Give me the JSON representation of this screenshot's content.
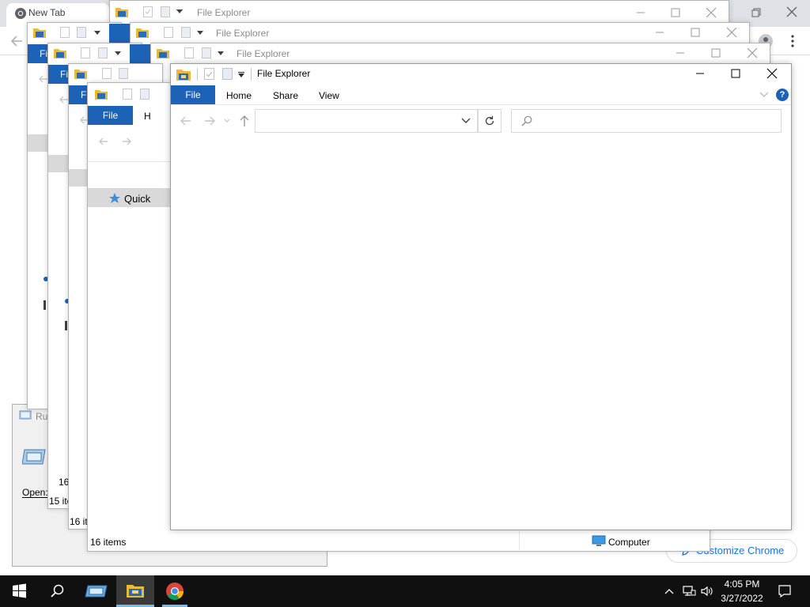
{
  "chrome": {
    "tab_title": "New Tab",
    "customize_label": "Customize Chrome"
  },
  "run_dialog": {
    "title": "Ru",
    "open_label": "Open:"
  },
  "explorer_back": [
    {
      "title": "File Explorer"
    },
    {
      "title": "File Explorer"
    },
    {
      "title": "File Explorer"
    }
  ],
  "explorer_left": [
    {
      "file_tab": "Fi",
      "status": "16"
    },
    {
      "file_tab": "Fi",
      "status": "15 ite"
    },
    {
      "file_tab": "Fi",
      "status": "16 it"
    },
    {
      "file_tab": "File",
      "home_partial": "H",
      "nav_item": "Quick",
      "status": "16 items",
      "status_right": "Computer"
    }
  ],
  "main_explorer": {
    "title": "File Explorer",
    "tabs": {
      "file": "File",
      "home": "Home",
      "share": "Share",
      "view": "View"
    },
    "help": "?",
    "address_value": "",
    "search_placeholder": ""
  },
  "taskbar": {
    "time": "4:05 PM",
    "date": "3/27/2022"
  },
  "colors": {
    "accent": "#1c63b7",
    "taskbar": "#101010",
    "chrome_frame": "#dee1e6",
    "link_blue": "#1a73e8"
  },
  "icons": [
    "chrome-logo-icon",
    "folder-icon",
    "checkbox-icon",
    "undo-icon",
    "dropdown-arrow-icon",
    "minimize-icon",
    "maximize-icon",
    "close-icon",
    "restore-icon",
    "back-arrow-icon",
    "forward-arrow-icon",
    "up-arrow-icon",
    "refresh-icon",
    "search-icon",
    "star-icon",
    "computer-icon",
    "windows-start-icon",
    "search-taskbar-icon",
    "run-app-icon",
    "file-explorer-taskbar-icon",
    "chrome-taskbar-icon",
    "chevron-up-icon",
    "network-icon",
    "volume-icon",
    "notification-icon",
    "profile-icon",
    "more-icon",
    "pencil-icon"
  ]
}
